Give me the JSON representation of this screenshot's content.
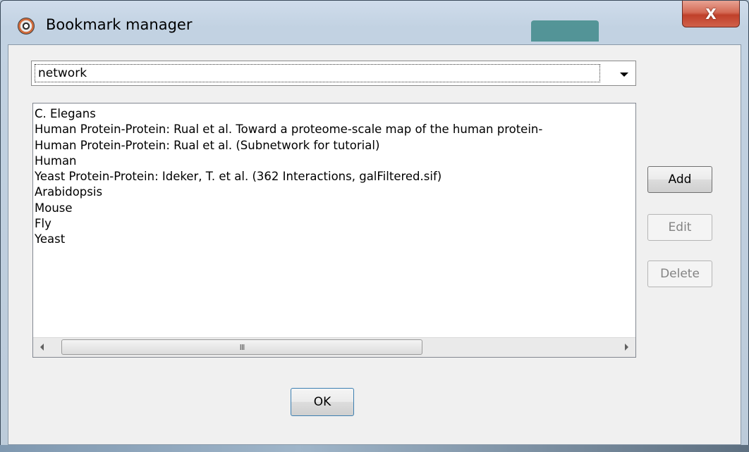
{
  "window": {
    "title": "Bookmark manager",
    "close_glyph": "X",
    "app_icon": "cytoscape-icon"
  },
  "combo": {
    "selected": "network",
    "arrow_icon": "chevron-down-icon"
  },
  "list": {
    "items": [
      "C. Elegans",
      "Human Protein-Protein: Rual et al. Toward a proteome-scale map of the human protein-",
      "Human Protein-Protein: Rual et al. (Subnetwork for tutorial)",
      "Human",
      "Yeast Protein-Protein: Ideker, T. et al. (362 Interactions, galFiltered.sif)",
      "Arabidopsis",
      "Mouse",
      "Fly",
      "Yeast"
    ],
    "scroll_thumb_grip": "III"
  },
  "buttons": {
    "add": "Add",
    "edit": "Edit",
    "delete": "Delete",
    "ok": "OK"
  },
  "colors": {
    "close_red": "#c0402a",
    "ok_focus_border": "#3c7fb1",
    "disabled_text": "#838383"
  }
}
